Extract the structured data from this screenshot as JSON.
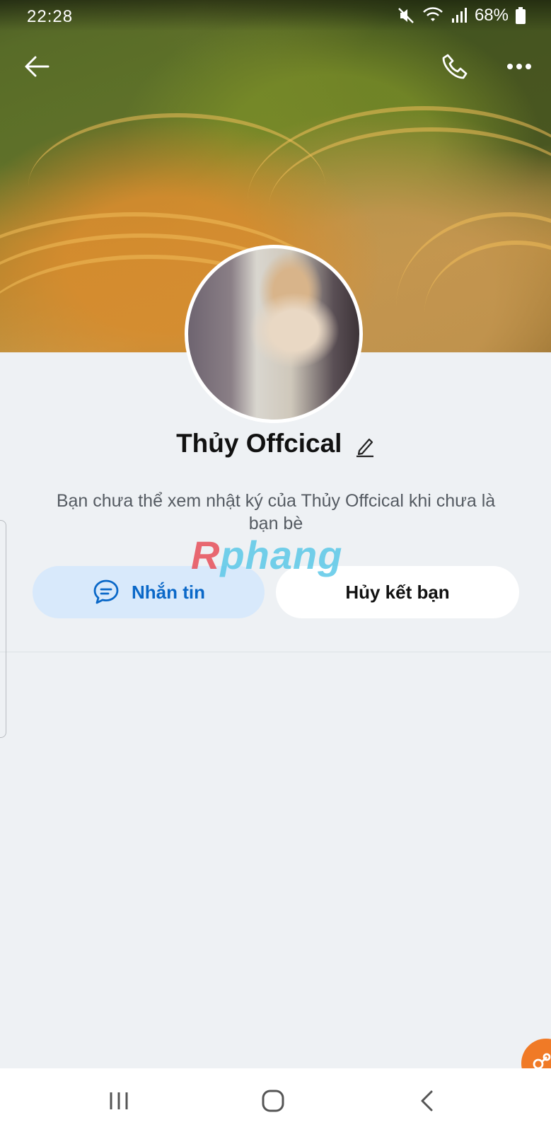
{
  "status_bar": {
    "time": "22:28",
    "battery": "68%",
    "icons": [
      "mute-icon",
      "wifi-icon",
      "signal-icon",
      "battery-icon"
    ]
  },
  "header": {
    "back_icon": "arrow-left-icon",
    "call_icon": "phone-icon",
    "more_icon": "more-dots-icon"
  },
  "profile": {
    "name": "Thủy Offcical",
    "edit_icon": "pencil-icon",
    "info_text": "Bạn chưa thể xem nhật ký của Thủy Offcical khi chưa là bạn bè"
  },
  "watermark": {
    "first": "R",
    "rest": "phang"
  },
  "actions": {
    "message_label": "Nhắn tin",
    "message_icon": "chat-bubble-icon",
    "unfriend_label": "Hủy kết bạn"
  },
  "colors": {
    "accent": "#0a68c8",
    "message_bg": "#d8e9fb",
    "background": "#eef1f4",
    "fab": "#f07a26"
  },
  "navbar": {
    "items": [
      "recent-apps-icon",
      "home-icon",
      "back-icon"
    ]
  }
}
